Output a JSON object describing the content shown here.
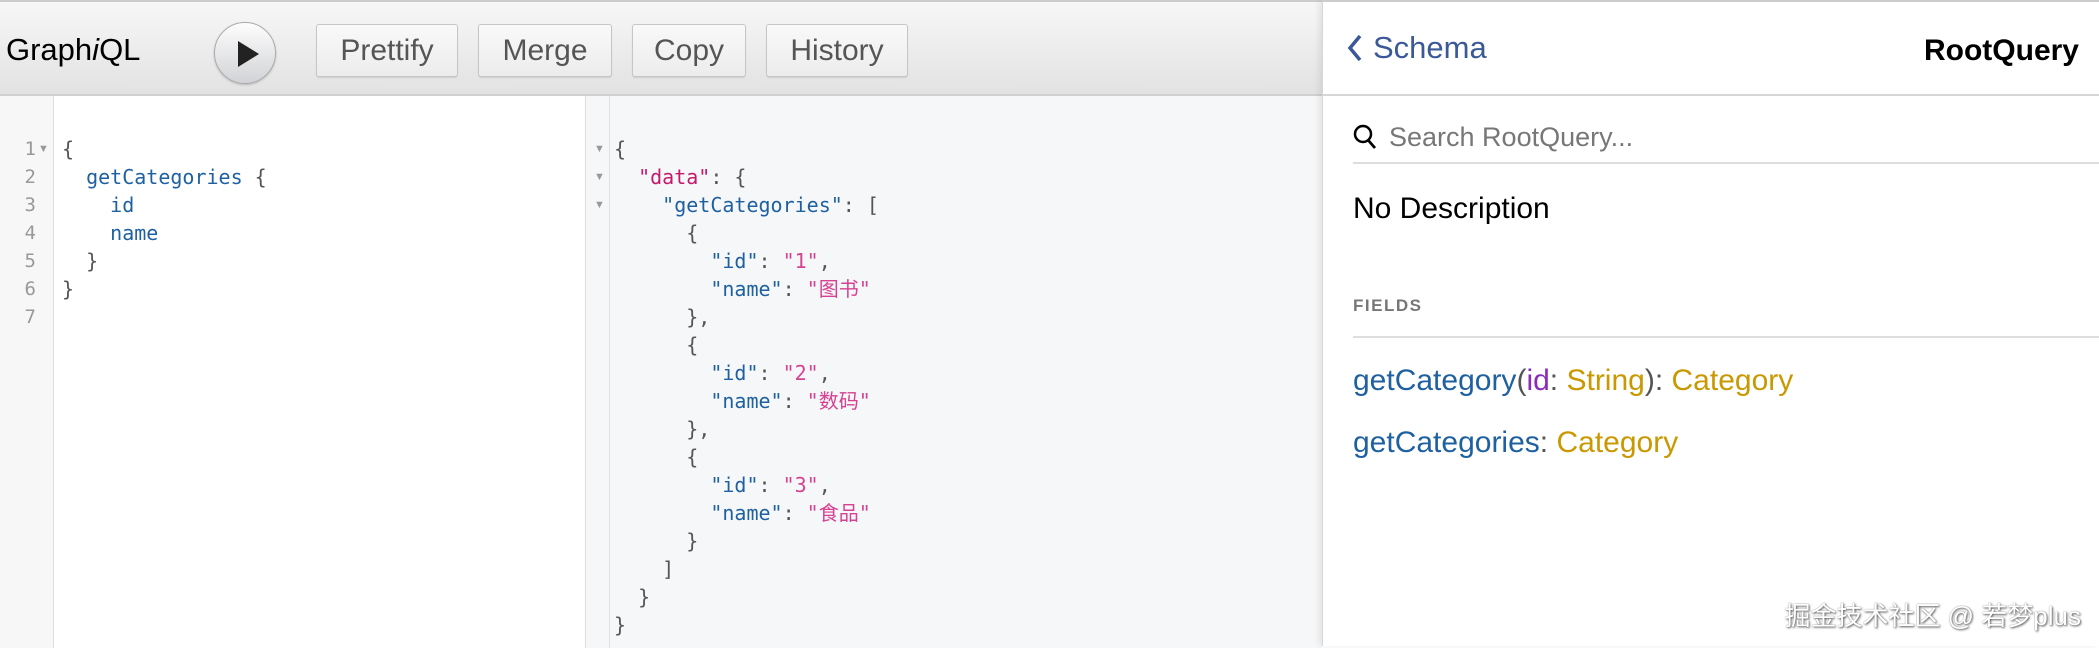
{
  "toolbar": {
    "logo_pre": "Graph",
    "logo_i": "i",
    "logo_post": "QL",
    "buttons": {
      "prettify": "Prettify",
      "merge": "Merge",
      "copy": "Copy",
      "history": "History"
    }
  },
  "query_editor": {
    "line_numbers": [
      "1",
      "2",
      "3",
      "4",
      "5",
      "6",
      "7"
    ],
    "lines": [
      "{",
      "  getCategories {",
      "    id",
      "    name",
      "  }",
      "}",
      ""
    ]
  },
  "result": {
    "categories": [
      {
        "id": "1",
        "name": "图书"
      },
      {
        "id": "2",
        "name": "数码"
      },
      {
        "id": "3",
        "name": "食品"
      }
    ],
    "keys": {
      "data": "\"data\"",
      "getCategories": "\"getCategories\"",
      "id": "\"id\"",
      "name": "\"name\""
    }
  },
  "doc": {
    "back_label": "Schema",
    "title": "RootQuery",
    "search_placeholder": "Search RootQuery...",
    "description": "No Description",
    "fields_heading": "FIELDS",
    "fields": [
      {
        "name": "getCategory",
        "arg_name": "id",
        "arg_type": "String",
        "type": "Category"
      },
      {
        "name": "getCategories",
        "type": "Category"
      }
    ]
  },
  "watermark": "掘金技术社区 @ 若梦plus",
  "colors": {
    "accent": "#3b5998",
    "field": "#1f61a0",
    "type": "#ca9800",
    "arg": "#8b2bb9",
    "string": "#d64292"
  }
}
